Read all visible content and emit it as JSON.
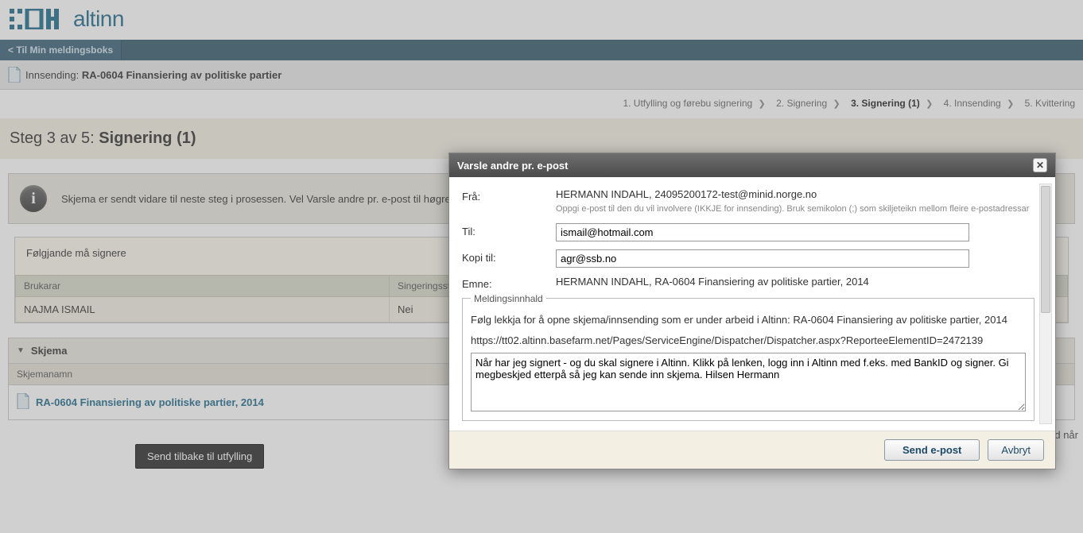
{
  "header": {
    "brand": "altinn"
  },
  "breadcrumb": {
    "back": "< Til Min meldingsboks"
  },
  "submission": {
    "prefix": "Innsending: ",
    "title": "RA-0604 Finansiering av politiske partier"
  },
  "steps": {
    "items": [
      {
        "label": "1. Utfylling og førebu signering"
      },
      {
        "label": "2. Signering"
      },
      {
        "label": "3. Signering (1)"
      },
      {
        "label": "4. Innsending"
      },
      {
        "label": "5. Kvittering"
      }
    ],
    "active_index": 2
  },
  "page_title": {
    "prefix": "Steg 3 av 5: ",
    "name": "Signering (1)"
  },
  "info": {
    "text": "Skjema er sendt vidare til neste steg i prosessen. Vel Varsle andre pr. e-post til høgre dersom du vil sende ei e-postmelding til andre personar som må signere. Du finn att skjema/innsendingstenestre…"
  },
  "signers": {
    "heading": "Følgjande må signere",
    "cols": {
      "user": "Brukarar",
      "status": "Singeringsstatus"
    },
    "rows": [
      {
        "user": "NAJMA ISMAIL",
        "status": "Nei"
      }
    ]
  },
  "skjema": {
    "title": "Skjema",
    "col": "Skjemanamn",
    "row_label": "RA-0604 Finansiering av politiske partier, 2014"
  },
  "send_back": "Send tilbake til utfylling",
  "truncated_right": "d når",
  "modal": {
    "title": "Varsle andre pr. e-post",
    "from_label": "Frå:",
    "from_value": "HERMANN INDAHL, 24095200172-test@minid.norge.no",
    "from_hint": "Oppgi e-post til den du vil involvere (IKKJE for innsending). Bruk semikolon (;) som skiljeteikn mellom fleire e-postadressar",
    "to_label": "Til:",
    "to_value": "ismail@hotmail.com",
    "cc_label": "Kopi til:",
    "cc_value": "agr@ssb.no",
    "subject_label": "Emne:",
    "subject_value": "HERMANN INDAHL, RA-0604 Finansiering av politiske partier, 2014",
    "fieldset_legend": "Meldingsinnhald",
    "body_intro": "Følg lekkja for å opne skjema/innsending som er under arbeid i Altinn: RA-0604 Finansiering av politiske partier, 2014",
    "body_link": "https://tt02.altinn.basefarm.net/Pages/ServiceEngine/Dispatcher/Dispatcher.aspx?ReporteeElementID=2472139",
    "body_text": "Når har jeg signert - og du skal signere i Altinn. Klikk på lenken, logg inn i Altinn med f.eks. med BankID og signer. Gi megbeskjed etterpå så jeg kan sende inn skjema. Hilsen Hermann",
    "send": "Send e-post",
    "cancel": "Avbryt"
  }
}
